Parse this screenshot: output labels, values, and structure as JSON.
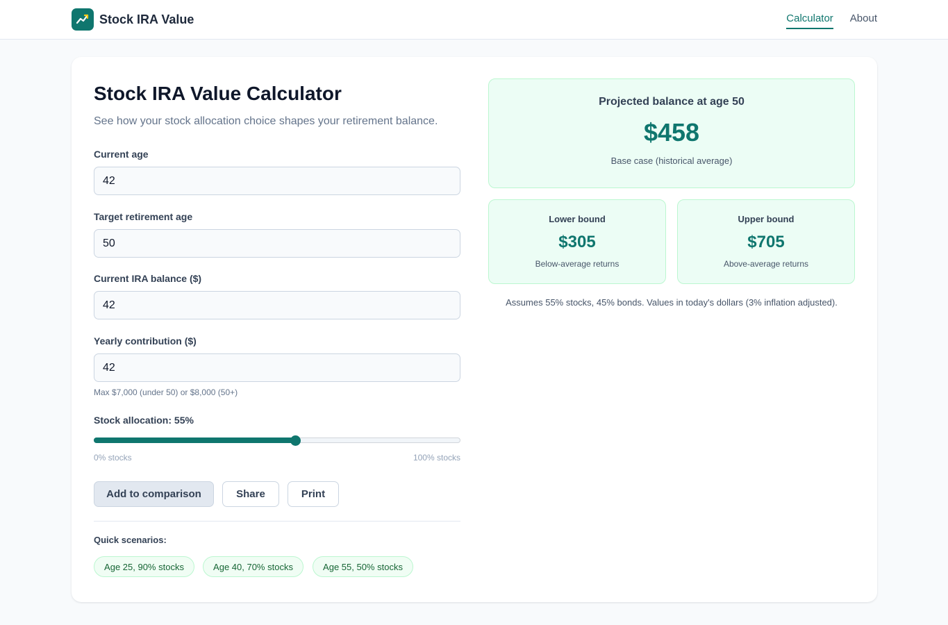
{
  "header": {
    "brand": "Stock IRA Value",
    "nav": [
      "Calculator",
      "About"
    ]
  },
  "calculator": {
    "title": "Stock IRA Value Calculator",
    "subtitle": "See how your stock allocation choice shapes your retirement balance.",
    "fields": {
      "current_age": {
        "label": "Current age",
        "value": "42"
      },
      "target_age": {
        "label": "Target retirement age",
        "value": "50"
      },
      "balance": {
        "label": "Current IRA balance ($)",
        "value": "42"
      },
      "contribution": {
        "label": "Yearly contribution ($)",
        "value": "42",
        "hint": "Max $7,000 (under 50) or $8,000 (50+)"
      }
    },
    "allocation": {
      "label": "Stock allocation: 55%",
      "value_percent": 55,
      "min_label": "0% stocks",
      "max_label": "100% stocks"
    },
    "buttons": {
      "compare": "Add to comparison",
      "share": "Share",
      "print": "Print"
    },
    "scenarios": {
      "label": "Quick scenarios:",
      "items": [
        "Age 25, 90% stocks",
        "Age 40, 70% stocks",
        "Age 55, 50% stocks"
      ]
    }
  },
  "results": {
    "main": {
      "title": "Projected balance at age 50",
      "value": "$458",
      "note": "Base case (historical average)"
    },
    "lower": {
      "title": "Lower bound",
      "value": "$305",
      "note": "Below-average returns"
    },
    "upper": {
      "title": "Upper bound",
      "value": "$705",
      "note": "Above-average returns"
    },
    "assumption": "Assumes 55% stocks, 45% bonds. Values in today's dollars (3% inflation adjusted)."
  },
  "colors": {
    "accent": "#0f766e",
    "result_bg": "#ecfdf5",
    "result_border": "#bbf7d0"
  },
  "icons": {
    "logo": "trending-up-icon"
  }
}
